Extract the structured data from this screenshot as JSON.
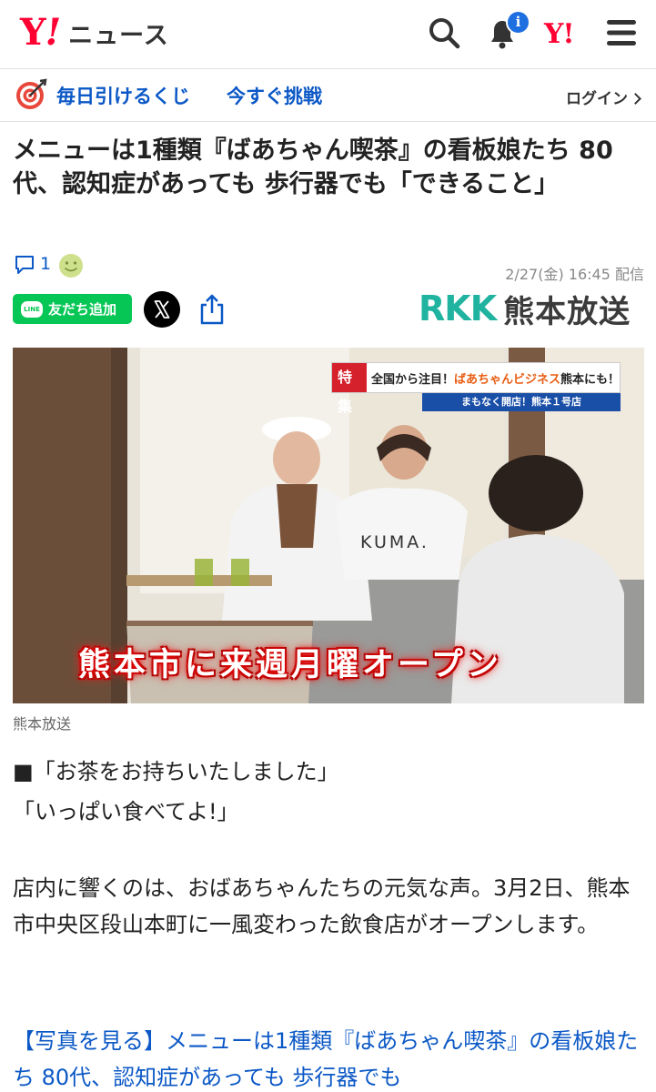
{
  "header": {
    "logo_y": "Y",
    "logo_mark": "!",
    "logo_news": "ニュース",
    "notification_badge": "i",
    "yahoo_small": "Y!",
    "icons": [
      "search-icon",
      "bell-icon",
      "yahoo-icon",
      "menu-icon"
    ]
  },
  "promo": {
    "text1": "毎日引けるくじ",
    "text2": "今すぐ挑戦",
    "login": "ログイン"
  },
  "article": {
    "title": "メニューは1種類『ばあちゃん喫茶』の看板娘たち 80代、認知症があっても 歩行器でも「できること」",
    "comment_count": "1",
    "date": "2/27(金) 16:45 配信",
    "share": {
      "line_logo": "LINE",
      "line_label": "友だち追加"
    },
    "publisher_latin": "RKK",
    "publisher_jp": "熊本放送",
    "photo": {
      "banner_tag": "特集",
      "banner_text1": "全国から注目！",
      "banner_text2": "ばあちゃんビジネス",
      "banner_text3": "熊本にも！",
      "banner_sub": "まもなく開店！熊本１号店",
      "shirt_text": "KUMA.",
      "overlay": "熊本市に来週月曜オープン"
    },
    "caption": "熊本放送",
    "body": {
      "line1": "■「お茶をお持ちいたしました」",
      "line2": "「いっぱい食べてよ!」",
      "para": "店内に響くのは、おばあちゃんたちの元気な声。3月2日、熊本市中央区段山本町に一風変わった飲食店がオープンします。",
      "link": "【写真を見る】メニューは1種類『ばあちゃん喫茶』の看板娘たち 80代、認知症があっても 歩行器でも"
    }
  },
  "colors": {
    "yahoo_red": "#ff0033",
    "link_blue": "#0b58c6",
    "line_green": "#06c755",
    "rkk_teal": "#20b3a0"
  }
}
